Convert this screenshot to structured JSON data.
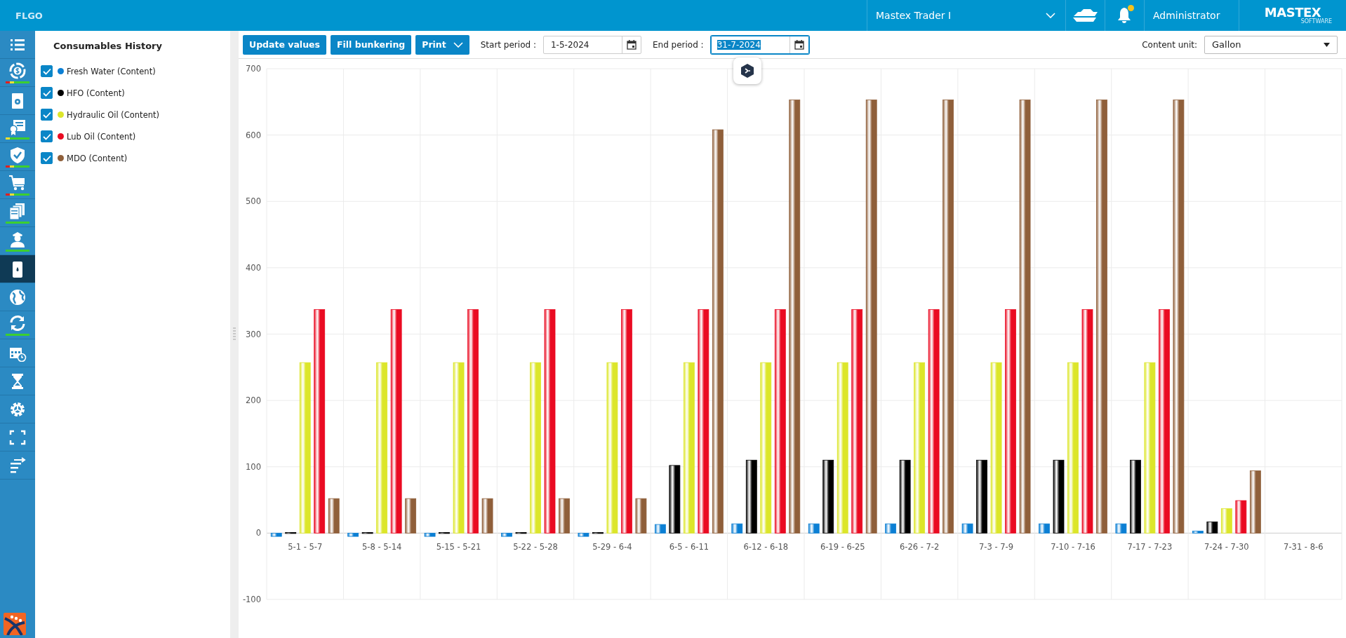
{
  "app": {
    "title": "FLGO",
    "vessel": "Mastex Trader I",
    "user": "Administrator",
    "logo": {
      "name": "MASTEX",
      "tagline": "SOFTWARE"
    },
    "notification_dot": true
  },
  "nav": [
    {
      "kind": "list",
      "selected": false
    },
    {
      "kind": "dollar",
      "selected": false,
      "status": [
        {
          "color": "#e02020"
        },
        {
          "color": "#f0e030"
        },
        {
          "color": "#3ccf2e"
        }
      ]
    },
    {
      "kind": "doc-gear",
      "selected": false
    },
    {
      "kind": "certificate",
      "selected": false,
      "status": [
        {
          "color": "#f0e030"
        },
        {
          "color": "#3ccf2e"
        }
      ]
    },
    {
      "kind": "shield",
      "selected": false,
      "status": [
        {
          "color": "#e02020"
        },
        {
          "color": "#f0e030"
        },
        {
          "color": "#3ccf2e"
        }
      ]
    },
    {
      "kind": "cart",
      "selected": false,
      "status": [
        {
          "color": "#e02020"
        },
        {
          "color": "#f0e030"
        },
        {
          "color": "#3ccf2e"
        }
      ]
    },
    {
      "kind": "documents",
      "selected": false,
      "status": [
        {
          "color": "#3ccf2e"
        }
      ]
    },
    {
      "kind": "officer",
      "selected": false,
      "status": [
        {
          "color": "#3ccf2e"
        }
      ]
    },
    {
      "kind": "barrel",
      "selected": true
    },
    {
      "kind": "globe",
      "selected": false
    },
    {
      "kind": "sync",
      "selected": false,
      "status": [
        {
          "color": "#3ccf2e"
        }
      ]
    },
    {
      "kind": "calendar",
      "selected": false
    },
    {
      "kind": "hourglass",
      "selected": false
    },
    {
      "kind": "gear",
      "selected": false
    },
    {
      "kind": "fullscreen",
      "selected": false
    },
    {
      "kind": "sort",
      "selected": false
    }
  ],
  "panel": {
    "title": "Consumables History",
    "series": [
      {
        "label": "Fresh Water (Content)",
        "checked": true,
        "color": "#0b7fd4"
      },
      {
        "label": "HFO (Content)",
        "checked": true,
        "color": "#000000"
      },
      {
        "label": "Hydraulic Oil (Content)",
        "checked": true,
        "color": "#dce62a"
      },
      {
        "label": "Lub Oil (Content)",
        "checked": true,
        "color": "#ea0b22"
      },
      {
        "label": "MDO (Content)",
        "checked": true,
        "color": "#8f5f3a"
      }
    ]
  },
  "toolbar": {
    "buttons": [
      {
        "label": "Update values",
        "kind": "plain"
      },
      {
        "label": "Fill bunkering",
        "kind": "plain"
      },
      {
        "label": "Print",
        "kind": "menu"
      }
    ],
    "start": {
      "label": "Start period :",
      "value": "1-5-2024",
      "selected": false
    },
    "end": {
      "label": "End period :",
      "value": "31-7-2024",
      "selected": true
    },
    "unit": {
      "label": "Content unit:",
      "value": "Gallon"
    }
  },
  "chart_data": {
    "type": "bar",
    "grid": true,
    "categories": [
      "5-1 - 5-7",
      "5-8 - 5-14",
      "5-15 - 5-21",
      "5-22 - 5-28",
      "5-29 - 6-4",
      "6-5 - 6-11",
      "6-12 - 6-18",
      "6-19 - 6-25",
      "6-26 - 7-2",
      "7-3 - 7-9",
      "7-10 - 7-16",
      "7-17 - 7-23",
      "7-24 - 7-30",
      "7-31 - 8-6"
    ],
    "series": [
      {
        "color": "#0b7fd4",
        "values": [
          -5,
          -5,
          -5,
          -5,
          -5,
          13,
          14,
          14,
          14,
          14,
          14,
          14,
          3,
          null
        ]
      },
      {
        "color": "#000000",
        "values": [
          1,
          1,
          1,
          1,
          1,
          102,
          110,
          110,
          110,
          110,
          110,
          110,
          17,
          null
        ]
      },
      {
        "color": "#dce62a",
        "values": [
          257,
          257,
          257,
          257,
          257,
          257,
          257,
          257,
          257,
          257,
          257,
          257,
          37,
          null
        ]
      },
      {
        "color": "#ea0b22",
        "values": [
          337,
          337,
          337,
          337,
          337,
          337,
          337,
          337,
          337,
          337,
          337,
          337,
          49,
          null
        ]
      },
      {
        "color": "#8f5f3a",
        "values": [
          52,
          52,
          52,
          52,
          52,
          608,
          653,
          653,
          653,
          653,
          653,
          653,
          94,
          null
        ]
      }
    ],
    "ylim": [
      -100,
      700
    ],
    "yticks": [
      -100,
      0,
      100,
      200,
      300,
      400,
      500,
      600,
      700
    ]
  }
}
